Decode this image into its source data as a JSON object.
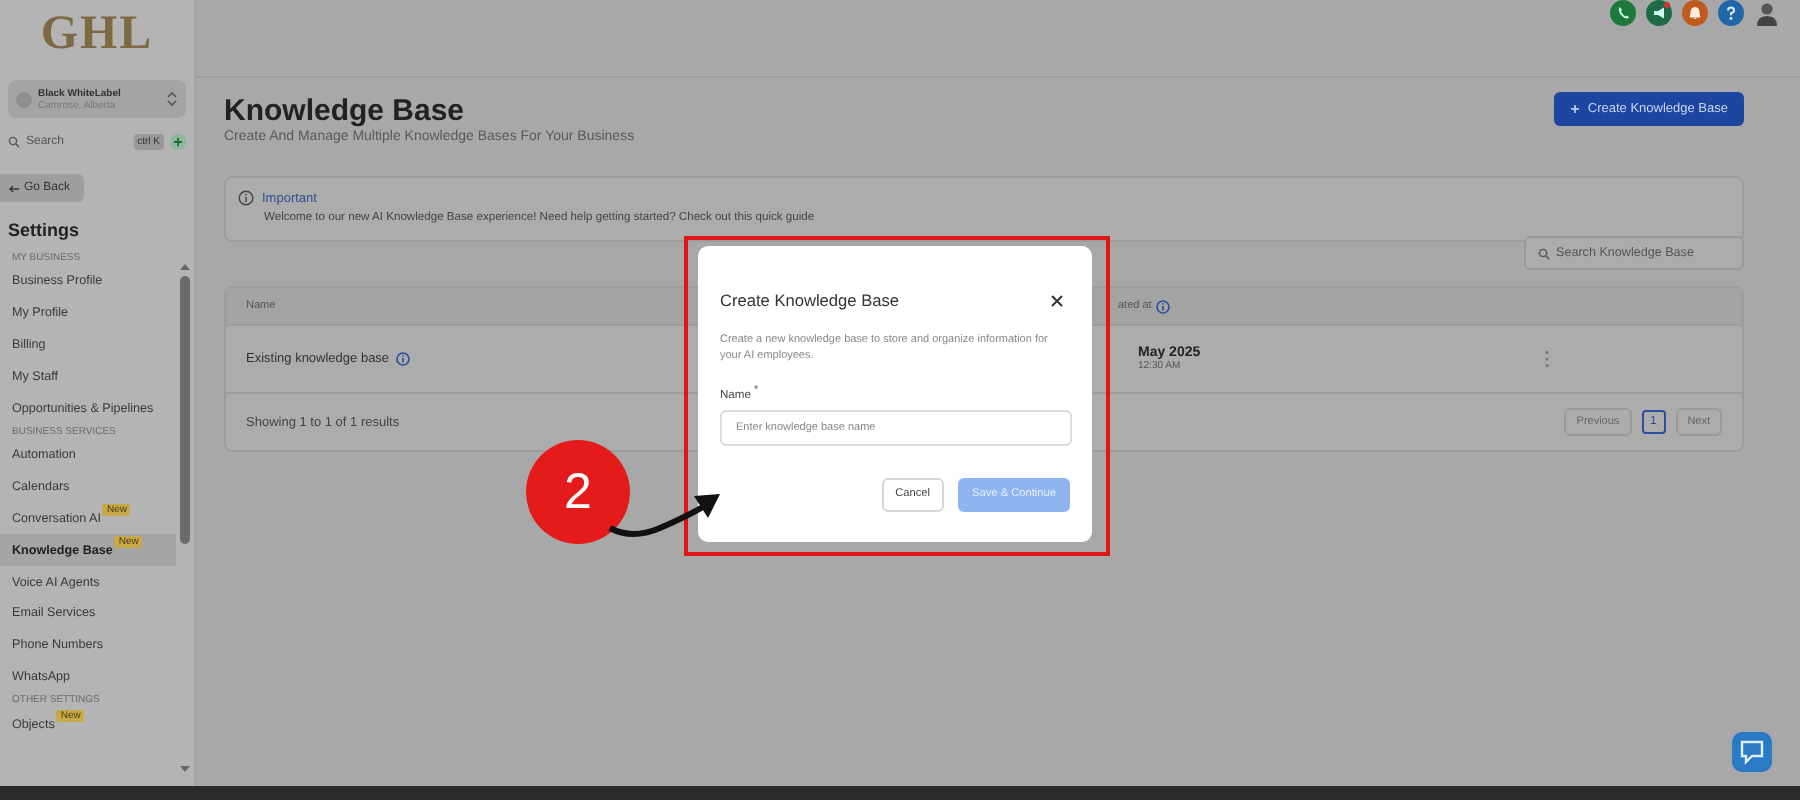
{
  "logo": "GHL",
  "account": {
    "name": "Black WhiteLabel",
    "location": "Camrose, Alberta"
  },
  "search": {
    "placeholder": "Search",
    "shortcut": "ctrl K"
  },
  "go_back": "Go Back",
  "settings_title": "Settings",
  "sidebar": [
    {
      "kind": "heading",
      "label": "MY BUSINESS"
    },
    {
      "kind": "item",
      "label": "Business Profile",
      "selected": false
    },
    {
      "kind": "item",
      "label": "My Profile",
      "selected": false
    },
    {
      "kind": "item",
      "label": "Billing",
      "selected": false
    },
    {
      "kind": "item",
      "label": "My Staff",
      "selected": false
    },
    {
      "kind": "item",
      "label": "Opportunities & Pipelines",
      "selected": false
    },
    {
      "kind": "heading",
      "label": "BUSINESS SERVICES"
    },
    {
      "kind": "item",
      "label": "Automation",
      "selected": false
    },
    {
      "kind": "item",
      "label": "Calendars",
      "selected": false
    },
    {
      "kind": "item",
      "label": "Conversation AI",
      "badge": "New",
      "selected": false
    },
    {
      "kind": "item",
      "label": "Knowledge Base",
      "badge": "New",
      "selected": true
    },
    {
      "kind": "item",
      "label": "Voice AI Agents",
      "selected": false
    },
    {
      "kind": "item",
      "label": "Email Services",
      "selected": false
    },
    {
      "kind": "item",
      "label": "Phone Numbers",
      "selected": false
    },
    {
      "kind": "item",
      "label": "WhatsApp",
      "selected": false
    },
    {
      "kind": "heading",
      "label": "OTHER SETTINGS"
    },
    {
      "kind": "item",
      "label": "Objects",
      "badge": "New",
      "selected": false
    }
  ],
  "header_icons": [
    {
      "kind": "phone",
      "color": "#1e7a3c"
    },
    {
      "kind": "megaphone",
      "color": "#1f6b48"
    },
    {
      "kind": "bell",
      "color": "#c05a1e"
    },
    {
      "kind": "help",
      "color": "#2166a8"
    },
    {
      "kind": "avatar"
    }
  ],
  "page": {
    "title": "Knowledge Base",
    "subtitle": "Create And Manage Multiple Knowledge Bases For Your Business",
    "create_button": "Create Knowledge Base"
  },
  "notice": {
    "title": "Important",
    "text": "Welcome to our new AI Knowledge Base experience! Need help getting started? Check out this quick guide"
  },
  "kb_search": {
    "placeholder": "Search Knowledge Base"
  },
  "table": {
    "columns": [
      "Name",
      "ated at"
    ],
    "rows": [
      {
        "name": "Existing knowledge base",
        "date": "May 2025",
        "time": "12:30 AM"
      }
    ],
    "summary": "Showing 1 to 1 of 1 results",
    "pagination": {
      "previous": "Previous",
      "pages": [
        {
          "label": "1",
          "selected": true
        }
      ],
      "next": "Next"
    }
  },
  "modal": {
    "title": "Create Knowledge Base",
    "description": "Create a new knowledge base to store and organize information for your AI employees.",
    "field_label": "Name $^{*}$",
    "placeholder": "Enter knowledge base name",
    "cancel": "Cancel",
    "save": "Save & Continue",
    "save_disabled": true
  },
  "step_badge": "2"
}
